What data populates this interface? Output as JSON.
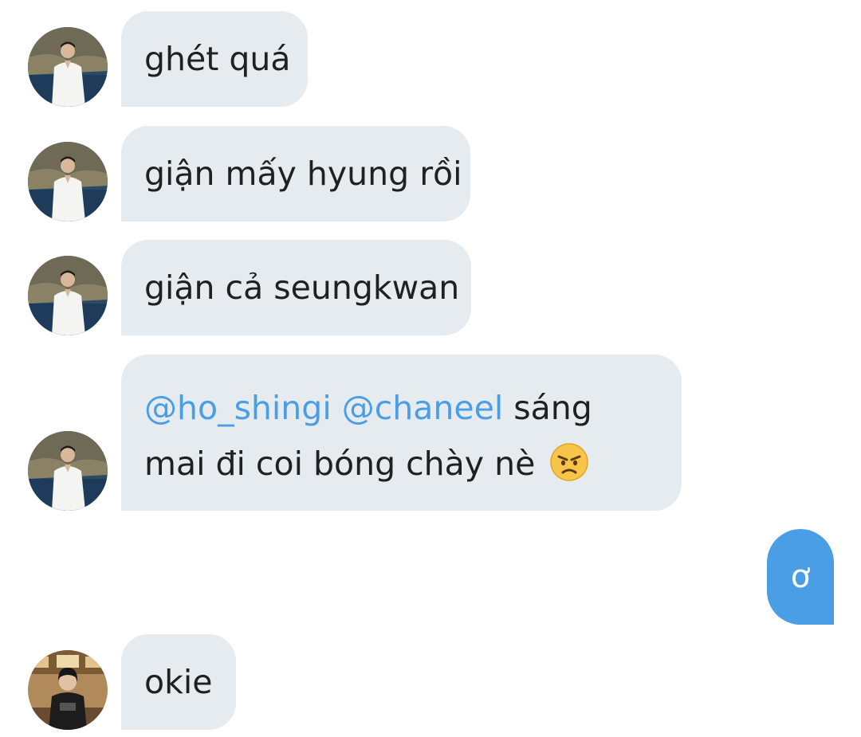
{
  "conversation": {
    "messages": [
      {
        "direction": "incoming",
        "sender_avatar": "avatar-man-white-shirt",
        "text": "ghét quá"
      },
      {
        "direction": "incoming",
        "sender_avatar": "avatar-man-white-shirt",
        "text": "giận mấy hyung rồi"
      },
      {
        "direction": "incoming",
        "sender_avatar": "avatar-man-white-shirt",
        "text": "giận cả seungkwan"
      },
      {
        "direction": "incoming",
        "sender_avatar": "avatar-man-white-shirt",
        "mention_1": "@ho_shingi",
        "mention_2": "@chaneel",
        "line_1_rest": "sáng",
        "line_2": "mai đi coi bóng chày nè",
        "emoji": "angry-face"
      },
      {
        "direction": "outgoing",
        "text": "ơ"
      },
      {
        "direction": "incoming",
        "sender_avatar": "avatar-person-dark-jacket",
        "text": "okie"
      }
    ]
  },
  "colors": {
    "incoming_bubble": "#e6ebef",
    "outgoing_bubble": "#4a9ee5",
    "mention": "#4a9ee5",
    "text": "#202020"
  }
}
